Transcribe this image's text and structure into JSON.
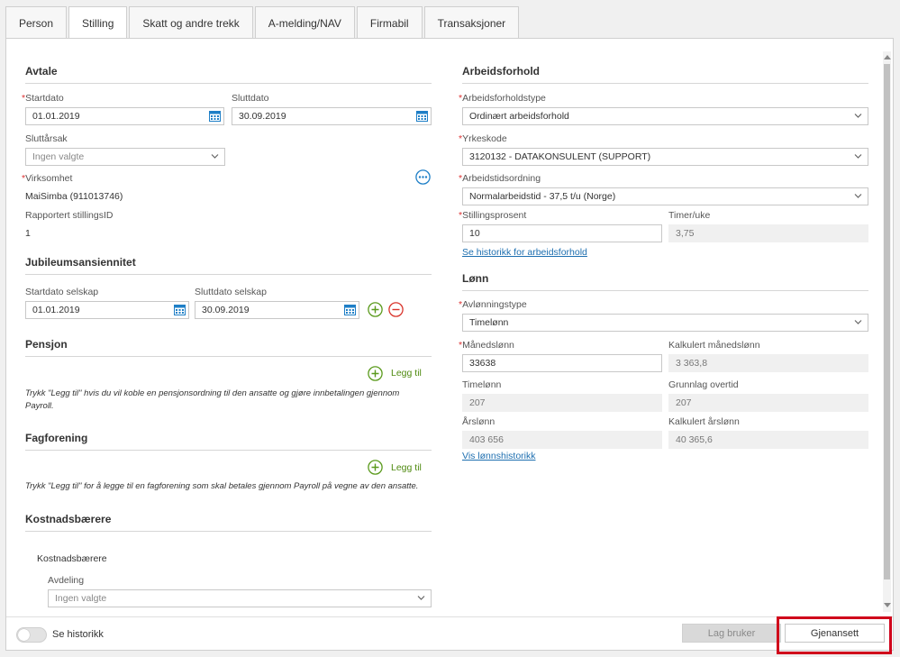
{
  "tabs": [
    "Person",
    "Stilling",
    "Skatt og andre trekk",
    "A-melding/NAV",
    "Firmabil",
    "Transaksjoner"
  ],
  "avtale": {
    "title": "Avtale",
    "startdato_label": "Startdato",
    "startdato": "01.01.2019",
    "sluttdato_label": "Sluttdato",
    "sluttdato": "30.09.2019",
    "sluttarsak_label": "Sluttårsak",
    "sluttarsak_placeholder": "Ingen valgte",
    "virksomhet_label": "Virksomhet",
    "virksomhet": "MaiSimba (911013746)",
    "stillingsid_label": "Rapportert stillingsID",
    "stillingsid": "1"
  },
  "jubileum": {
    "title": "Jubileumsansiennitet",
    "start_label": "Startdato selskap",
    "start": "01.01.2019",
    "slutt_label": "Sluttdato selskap",
    "slutt": "30.09.2019"
  },
  "pensjon": {
    "title": "Pensjon",
    "add_label": "Legg til",
    "note": "Trykk \"Legg til\" hvis du vil koble en pensjonsordning til den ansatte og gjøre innbetalingen gjennom Payroll."
  },
  "fagforening": {
    "title": "Fagforening",
    "add_label": "Legg til",
    "note": "Trykk \"Legg til\" for å legge til en fagforening som skal betales gjennom Payroll på vegne av den ansatte."
  },
  "kostnad": {
    "title": "Kostnadsbærere",
    "subtitle": "Kostnadsbærere",
    "avdeling_label": "Avdeling",
    "avdeling_placeholder": "Ingen valgte"
  },
  "arbeidsforhold": {
    "title": "Arbeidsforhold",
    "type_label": "Arbeidsforholdstype",
    "type": "Ordinært arbeidsforhold",
    "yrkeskode_label": "Yrkeskode",
    "yrkeskode": "3120132 - DATAKONSULENT (SUPPORT)",
    "tidsordning_label": "Arbeidstidsordning",
    "tidsordning": "Normalarbeidstid - 37,5 t/u (Norge)",
    "stillingsprosent_label": "Stillingsprosent",
    "stillingsprosent": "10",
    "timer_label": "Timer/uke",
    "timer": "3,75",
    "historikk_link": "Se historikk for arbeidsforhold"
  },
  "lonn": {
    "title": "Lønn",
    "type_label": "Avlønningstype",
    "type": "Timelønn",
    "maned_label": "Månedslønn",
    "maned": "33638",
    "kalk_maned_label": "Kalkulert månedslønn",
    "kalk_maned": "3 363,8",
    "time_label": "Timelønn",
    "time": "207",
    "overtid_label": "Grunnlag overtid",
    "overtid": "207",
    "ars_label": "Årslønn",
    "ars": "403 656",
    "kalk_ars_label": "Kalkulert årslønn",
    "kalk_ars": "40 365,6",
    "historikk_link": "Vis lønnshistorikk"
  },
  "footer": {
    "toggle_label": "Se historikk",
    "lag_bruker": "Lag bruker",
    "gjenansett": "Gjenansett"
  },
  "colors": {
    "accent_blue": "#1e7fc7",
    "add_green": "#5a9a1c",
    "remove_red": "#d9342b",
    "highlight_red": "#d0021b"
  }
}
